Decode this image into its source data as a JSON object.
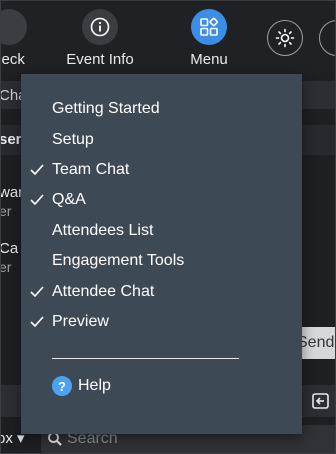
{
  "toolbar": {
    "check_label": "heck",
    "event_info_label": "Event Info",
    "menu_label": "Menu"
  },
  "background": {
    "chat_header": "Cha",
    "user_header": "sen",
    "entries": [
      {
        "name": "wan",
        "sub": "er"
      },
      {
        "name": "Ca",
        "sub": "er"
      }
    ],
    "send_label": "Send",
    "filter_label": "ox ▾",
    "search_placeholder": "Search"
  },
  "menu": {
    "items": [
      {
        "label": "Getting Started",
        "checked": false
      },
      {
        "label": "Setup",
        "checked": false
      },
      {
        "label": "Team Chat",
        "checked": true
      },
      {
        "label": "Q&A",
        "checked": true
      },
      {
        "label": "Attendees List",
        "checked": false
      },
      {
        "label": "Engagement Tools",
        "checked": false
      },
      {
        "label": "Attendee Chat",
        "checked": true
      },
      {
        "label": "Preview",
        "checked": true
      }
    ],
    "help_label": "Help",
    "help_icon_glyph": "?"
  },
  "colors": {
    "accent": "#3b8de6",
    "menu_bg": "#3d4955",
    "help_icon": "#4aa3f0"
  }
}
